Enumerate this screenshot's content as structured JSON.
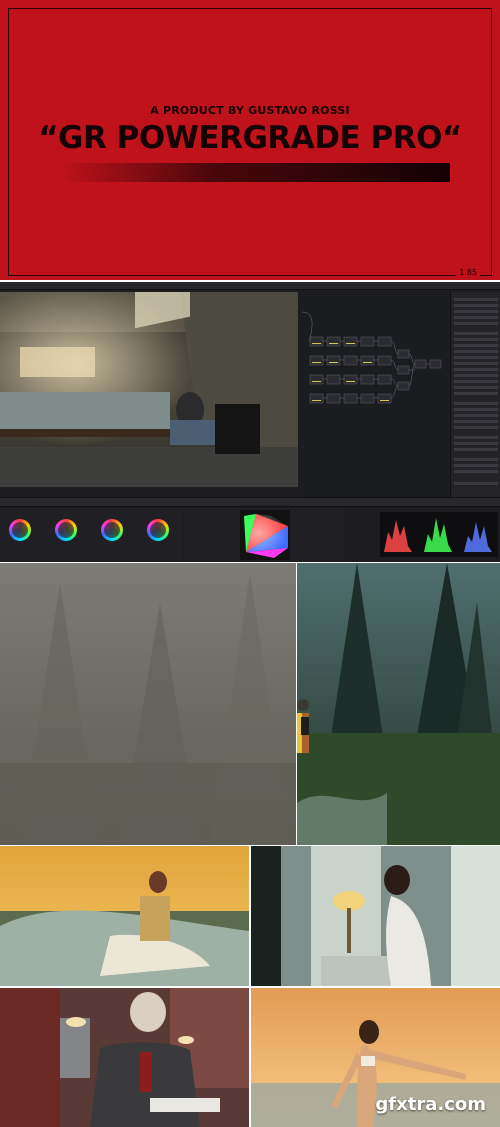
{
  "banner": {
    "subtitle": "A PRODUCT BY GUSTAVO ROSSI",
    "title": "“GR POWERGRADE PRO“",
    "aspect_ratio": "1.85",
    "background_color": "#c0121a",
    "text_color": "#140204"
  },
  "watermark": {
    "text": "gfxtra.com"
  },
  "colors": {
    "ui_background": "#1d1d20",
    "node_color": "#2b2c31",
    "node_highlight": "#d8c25a"
  },
  "icons": [
    "color-wheel-icon",
    "node-graph-icon",
    "waveform-icon"
  ]
}
